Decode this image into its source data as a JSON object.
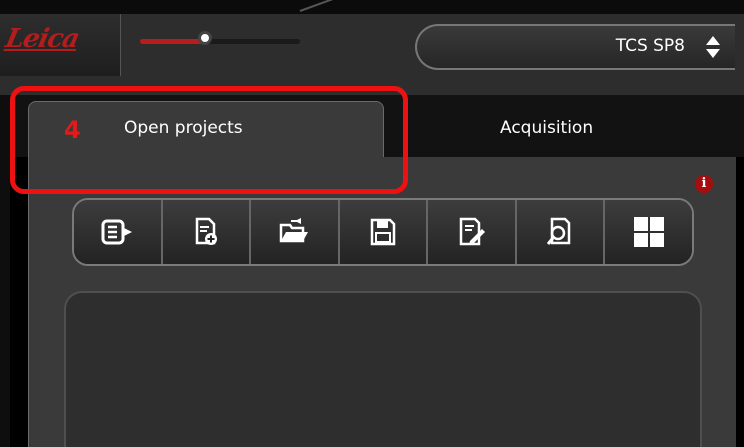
{
  "header": {
    "logo_text": "Leica",
    "system_select": {
      "value": "TCS SP8"
    },
    "zoom_slider": {
      "level_fraction": 0.42
    }
  },
  "tabs": [
    {
      "label": "Open projects",
      "active": true,
      "annotation_number": "4"
    },
    {
      "label": "Acquisition",
      "active": false
    }
  ],
  "toolbar": {
    "buttons": [
      {
        "icon": "export-list-icon"
      },
      {
        "icon": "new-project-icon"
      },
      {
        "icon": "open-folder-icon"
      },
      {
        "icon": "save-icon"
      },
      {
        "icon": "edit-document-icon"
      },
      {
        "icon": "search-document-icon"
      },
      {
        "icon": "grid-layout-icon"
      }
    ]
  },
  "info_badge": "i",
  "colors": {
    "brand_red": "#b41d1d",
    "highlight_red": "#ee1111",
    "panel_bg": "#3a3a3a",
    "toolbar_bg": "#1a1a1a"
  }
}
